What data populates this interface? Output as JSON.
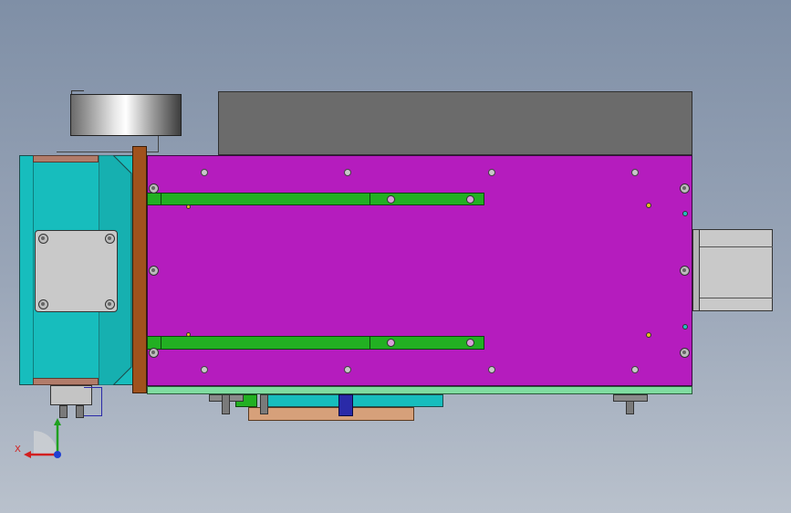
{
  "viewport": {
    "colors": {
      "background_top": "#7f8fa6",
      "background_bottom": "#b9c1cc",
      "main_plate": "#b51cbe",
      "side_housing": "#17bdbd",
      "rail": "#22b022",
      "motor_cover": "#6b6b6b",
      "bracket": "#a0521d",
      "bottom_base": "#7fdca0"
    }
  },
  "triad": {
    "x_label": "X",
    "x_color": "#d21f1f",
    "y_color": "#1fa01f",
    "z_color": "#1f3fd2"
  }
}
